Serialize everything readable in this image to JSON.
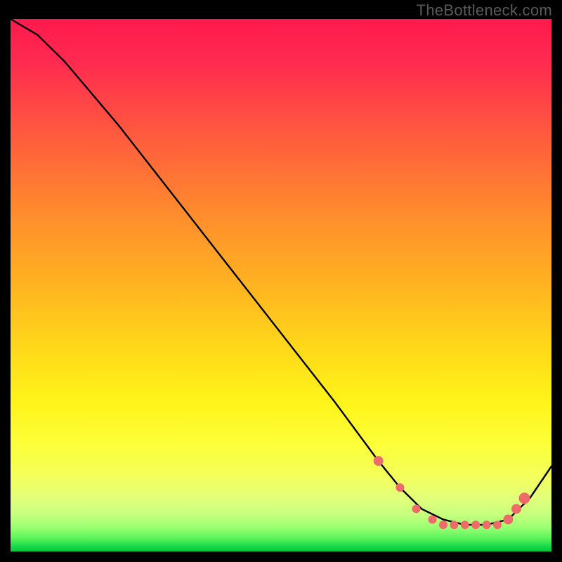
{
  "attribution": "TheBottleneck.com",
  "chart_data": {
    "type": "line",
    "title": "",
    "xlabel": "",
    "ylabel": "",
    "xlim": [
      0,
      100
    ],
    "ylim": [
      0,
      100
    ],
    "series": [
      {
        "name": "curve",
        "x": [
          0,
          5,
          10,
          20,
          30,
          40,
          50,
          60,
          68,
          72,
          76,
          80,
          84,
          88,
          92,
          96,
          100
        ],
        "y": [
          100,
          97,
          92,
          80,
          67,
          54,
          41,
          28,
          17,
          12,
          8,
          6,
          5,
          5,
          6,
          10,
          16
        ]
      }
    ],
    "markers": {
      "name": "dots",
      "x": [
        68,
        72,
        75,
        78,
        80,
        82,
        84,
        86,
        88,
        90,
        92,
        93.5,
        95
      ],
      "y": [
        17,
        12,
        8,
        6,
        5,
        5,
        5,
        5,
        5,
        5,
        6,
        8,
        10
      ],
      "r": [
        7,
        6,
        6,
        6,
        6,
        6,
        6,
        6,
        6,
        6,
        7,
        7,
        8
      ]
    },
    "gradient_stops": [
      {
        "pos": 0.0,
        "color": "#ff1a4d"
      },
      {
        "pos": 0.5,
        "color": "#ffd91a"
      },
      {
        "pos": 0.95,
        "color": "#9aff72"
      },
      {
        "pos": 1.0,
        "color": "#07c93c"
      }
    ]
  }
}
